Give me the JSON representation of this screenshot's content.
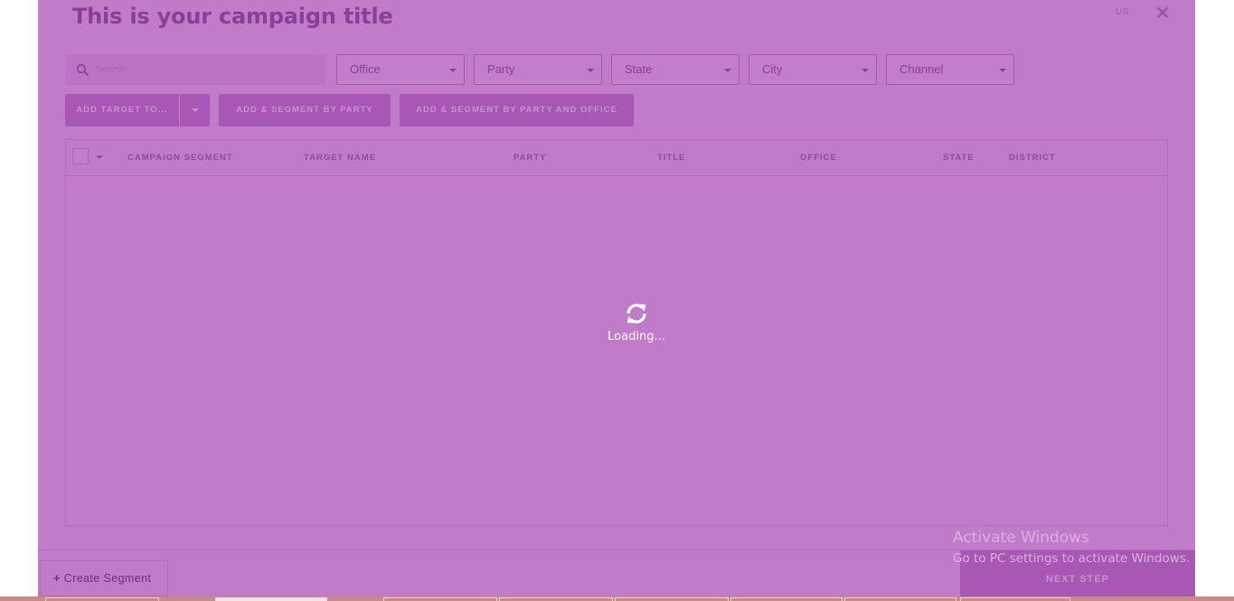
{
  "modal": {
    "title": "This is your campaign title",
    "locale": "US",
    "close_label": "✕"
  },
  "filters": {
    "search_placeholder": "Search",
    "dropdowns": [
      "Office",
      "Party",
      "State",
      "City",
      "Channel"
    ]
  },
  "actions": {
    "add_target": "ADD TARGET TO...",
    "segment_party": "ADD & SEGMENT BY PARTY",
    "segment_party_office": "ADD & SEGMENT BY PARTY AND OFFICE"
  },
  "table": {
    "columns": [
      "CAMPAIGN SEGMENT",
      "TARGET NAME",
      "PARTY",
      "TITLE",
      "OFFICE",
      "STATE",
      "DISTRICT"
    ]
  },
  "loader": {
    "icon": "refresh-icon",
    "text": "Loading..."
  },
  "footer": {
    "create_segment": "Create Segment",
    "next_step": "NEXT STEP"
  },
  "watermark": {
    "line1": "Activate Windows",
    "line2": "Go to PC settings to activate Windows."
  },
  "colors": {
    "overlay": "#c07bc9",
    "title": "#8a3f96",
    "button": "#a857b5"
  }
}
